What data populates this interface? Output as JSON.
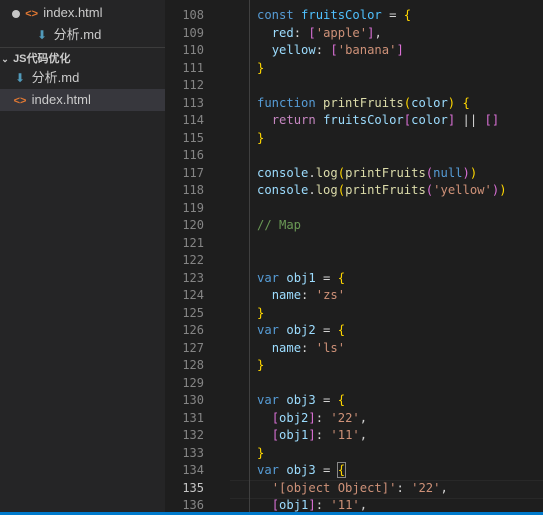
{
  "explorer": {
    "items": [
      {
        "label": "index.html",
        "icon": "html-file-icon",
        "modified": true
      },
      {
        "label": "分析.md",
        "icon": "markdown-file-icon"
      },
      {
        "label": "JS代码优化",
        "section": true
      },
      {
        "label": "分析.md",
        "icon": "markdown-file-icon"
      },
      {
        "label": "index.html",
        "icon": "html-file-icon",
        "active": true
      }
    ]
  },
  "editor": {
    "current_line": "135",
    "lines": [
      {
        "n": "108",
        "text": "const fruitsColor = {"
      },
      {
        "n": "109",
        "text": "  red: ['apple'],"
      },
      {
        "n": "110",
        "text": "  yellow: ['banana']"
      },
      {
        "n": "111",
        "text": "}"
      },
      {
        "n": "112",
        "text": ""
      },
      {
        "n": "113",
        "text": "function printFruits(color) {"
      },
      {
        "n": "114",
        "text": "  return fruitsColor[color] || []"
      },
      {
        "n": "115",
        "text": "}"
      },
      {
        "n": "116",
        "text": ""
      },
      {
        "n": "117",
        "text": "console.log(printFruits(null))"
      },
      {
        "n": "118",
        "text": "console.log(printFruits('yellow'))"
      },
      {
        "n": "119",
        "text": ""
      },
      {
        "n": "120",
        "text": "// Map"
      },
      {
        "n": "121",
        "text": ""
      },
      {
        "n": "122",
        "text": ""
      },
      {
        "n": "123",
        "text": "var obj1 = {"
      },
      {
        "n": "124",
        "text": "  name: 'zs'"
      },
      {
        "n": "125",
        "text": "}"
      },
      {
        "n": "126",
        "text": "var obj2 = {"
      },
      {
        "n": "127",
        "text": "  name: 'ls'"
      },
      {
        "n": "128",
        "text": "}"
      },
      {
        "n": "129",
        "text": ""
      },
      {
        "n": "130",
        "text": "var obj3 = {"
      },
      {
        "n": "131",
        "text": "  [obj2]: '22',"
      },
      {
        "n": "132",
        "text": "  [obj1]: '11',"
      },
      {
        "n": "133",
        "text": "}"
      },
      {
        "n": "134",
        "text": "var obj3 = {"
      },
      {
        "n": "135",
        "text": "  '[object Object]': '22',"
      },
      {
        "n": "136",
        "text": "  [obj1]: '11',"
      }
    ]
  }
}
